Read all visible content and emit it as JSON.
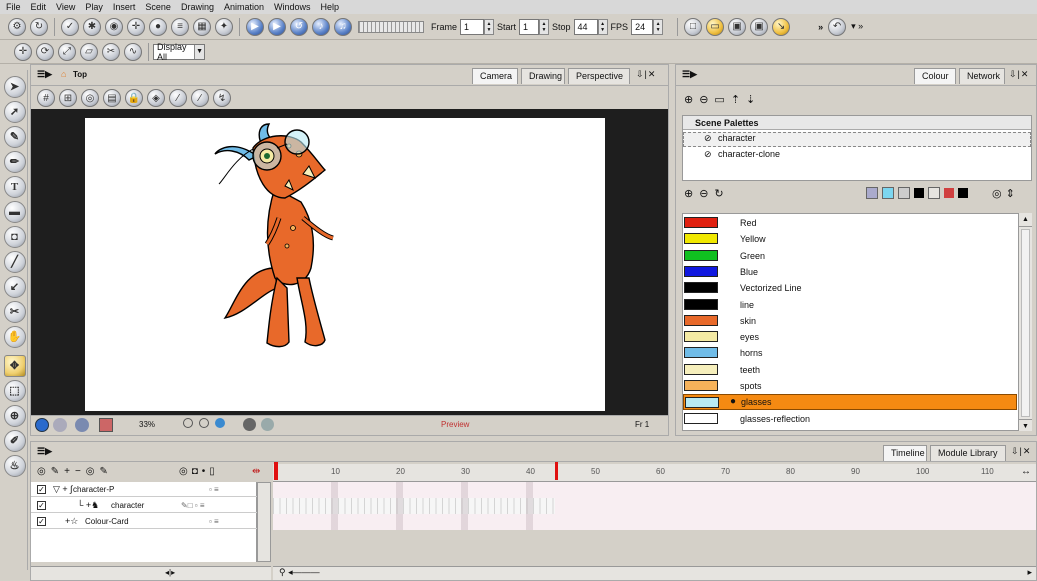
{
  "menu": [
    "File",
    "Edit",
    "View",
    "Play",
    "Insert",
    "Scene",
    "Drawing",
    "Animation",
    "Windows",
    "Help"
  ],
  "playback": {
    "frame_label": "Frame",
    "frame_value": "1",
    "start_label": "Start",
    "start_value": "1",
    "stop_label": "Stop",
    "stop_value": "44",
    "fps_label": "FPS",
    "fps_value": "24"
  },
  "display": {
    "selected": "Display All"
  },
  "camera_view": {
    "breadcrumb": "Top",
    "tabs": [
      "Camera",
      "Drawing",
      "Perspective"
    ],
    "zoom": "33%",
    "preview": "Preview",
    "frame": "Fr 1"
  },
  "colour_panel": {
    "tabs": [
      "Colour",
      "Network"
    ],
    "scene_palettes_title": "Scene Palettes",
    "palettes": [
      "character",
      "character-clone"
    ],
    "colours": [
      {
        "name": "Red",
        "hex": "#e02010"
      },
      {
        "name": "Yellow",
        "hex": "#f0e800"
      },
      {
        "name": "Green",
        "hex": "#10c020"
      },
      {
        "name": "Blue",
        "hex": "#1018e0"
      },
      {
        "name": "Vectorized Line",
        "hex": "#000000"
      },
      {
        "name": "line",
        "hex": "#000000"
      },
      {
        "name": "skin",
        "hex": "#e8692a"
      },
      {
        "name": "eyes",
        "hex": "#f4eaa4"
      },
      {
        "name": "horns",
        "hex": "#70bce8"
      },
      {
        "name": "teeth",
        "hex": "#f6efbc"
      },
      {
        "name": "spots",
        "hex": "#f6b25a"
      },
      {
        "name": "glasses",
        "hex": "#b8eaf4"
      },
      {
        "name": "glasses-reflection",
        "hex": "#ffffff"
      }
    ],
    "selected": "glasses"
  },
  "timeline": {
    "tabs": [
      "Timeline",
      "Module Library"
    ],
    "layers": [
      "character-P",
      "character",
      "Colour-Card"
    ],
    "ruler": [
      "10",
      "20",
      "30",
      "40",
      "50",
      "60",
      "70",
      "80",
      "90",
      "100",
      "110"
    ]
  },
  "colors": {
    "accent": "#f58a12",
    "panel": "#d4d0c8"
  }
}
